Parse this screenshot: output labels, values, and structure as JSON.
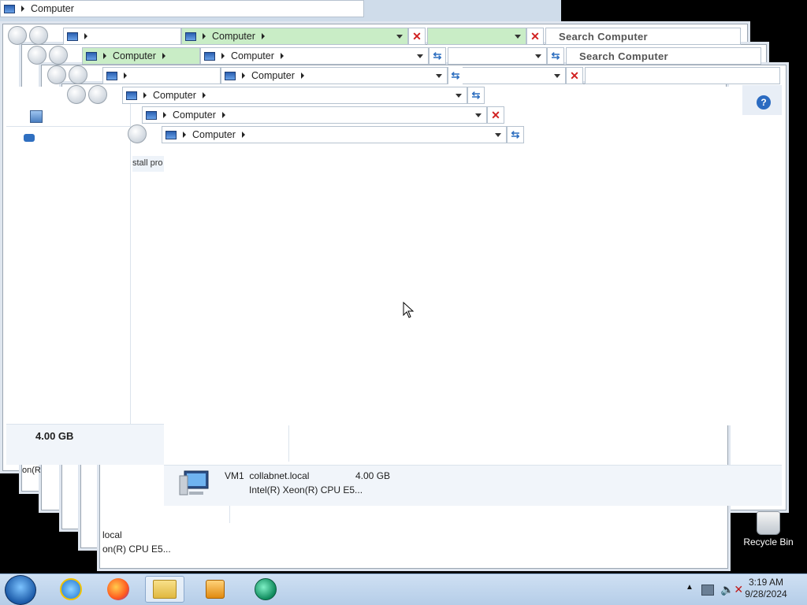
{
  "windows": {
    "top_address": "Computer",
    "address_labels": [
      "Computer",
      "Computer",
      "Computer",
      "Computer",
      "Computer",
      "Computer",
      "Computer"
    ],
    "search_placeholder_1": "Search Computer",
    "search_placeholder_2": "Search Computer"
  },
  "left_pane": {
    "memory_label": "4.00 GB",
    "partial_cpu_1": "on(R",
    "partial_local": "local",
    "partial_cpu_2": "on(R) CPU E5...",
    "partial_uninstall": "stall pro"
  },
  "details": {
    "computer_name": "VM1",
    "domain": "collabnet.local",
    "memory": "4.00 GB",
    "processor": "Intel(R) Xeon(R) CPU E5..."
  },
  "desktop": {
    "recycle_bin_label": "Recycle Bin"
  },
  "taskbar": {
    "time": "3:19 AM",
    "date": "9/28/2024",
    "apps": [
      "internet-explorer-icon",
      "firefox-icon",
      "file-explorer-icon",
      "media-player-icon",
      "app-icon"
    ]
  },
  "colors": {
    "accent_blue": "#2b6bc1",
    "close_red": "#d12020",
    "address_green": "#c9edc6"
  }
}
